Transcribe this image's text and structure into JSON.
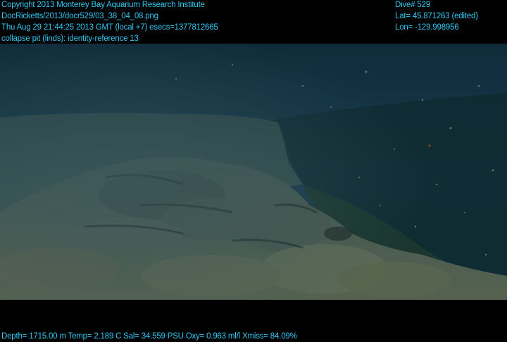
{
  "overlay": {
    "top_left": [
      "Copyright 2013 Monterey Bay Aquarium Research Institute",
      "DocRicketts/2013/docr529/03_38_04_08.png",
      "Thu Aug 29 21:44:25 2013 GMT (local +7)  esecs=1377812665",
      "collapse pit (linds): identity-reference 13"
    ],
    "top_right": [
      "Dive# 529",
      "Lat= 45.871263 (edited)",
      "Lon= -129.998956"
    ],
    "bottom": "Depth= 1715.00 m  Temp= 2.189 C  Sal= 34.559 PSU  Oxy= 0.963 ml/l  Xmiss= 84.09%"
  },
  "colors": {
    "overlay_text": "#33c8f2",
    "water": "#0e2a38",
    "rock": "#4a5a52"
  }
}
